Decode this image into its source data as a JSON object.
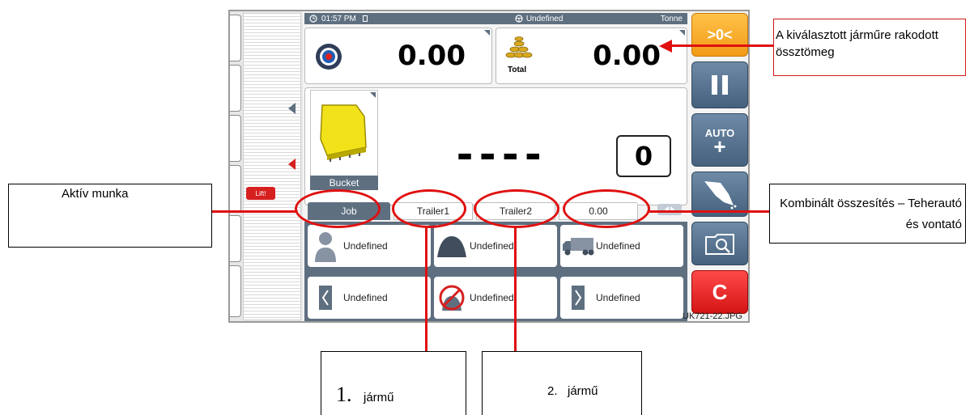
{
  "status": {
    "time": "01:57 PM",
    "vehicle": "Undefined",
    "unit": "Tonne"
  },
  "weights": {
    "current": "0.00",
    "total": "0.00",
    "total_label": "Total"
  },
  "bucket": {
    "label": "Bucket",
    "dashes": "----",
    "count": "0"
  },
  "lift_label": "Lift!",
  "tabs": [
    "Job",
    "Trailer1",
    "Trailer2",
    "0.00"
  ],
  "cells": [
    "Undefined",
    "Undefined",
    "Undefined",
    "Undefined",
    "Undefined",
    "Undefined"
  ],
  "buttons": {
    "zero": ">0<",
    "auto": "AUTO",
    "auto_plus": "+",
    "clear": "C"
  },
  "image_code": "UK721-22.JPG",
  "annotations": {
    "total_note": "A kiválasztott járműre rakodott össztömeg",
    "active_job": "Aktív munka",
    "combined": "Kombinált összesítés – Teherautó és vontató",
    "vehicle1_num": "1.",
    "vehicle1_word": "jármű",
    "vehicle2": "2.   jármű"
  },
  "colors": {
    "panel": "#5e6f80",
    "zero_button": "#f5a623",
    "clear_button": "#e8202a",
    "annotation": "#e01010"
  }
}
